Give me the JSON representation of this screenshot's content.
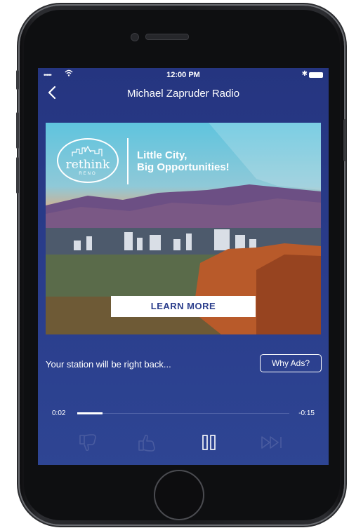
{
  "status_bar": {
    "signal": "•••••",
    "time": "12:00 PM",
    "bluetooth": "✱"
  },
  "nav": {
    "back_icon": "chevron-left-icon",
    "back_glyph": "‹",
    "title": "Michael Zapruder Radio"
  },
  "ad": {
    "logo_text": "rethink",
    "logo_subtext": "RENO",
    "headline_line1": "Little City,",
    "headline_line2": "Big Opportunities!",
    "cta_label": "LEARN MORE"
  },
  "station": {
    "message": "Your station will be right back...",
    "why_ads_label": "Why Ads?"
  },
  "playback": {
    "elapsed": "0:02",
    "remaining": "-0:15",
    "progress": 0.12
  },
  "controls": {
    "thumbs_down_icon": "thumbs-down-icon",
    "thumbs_up_icon": "thumbs-up-icon",
    "pause_icon": "pause-icon",
    "skip_icon": "skip-forward-icon"
  },
  "colors": {
    "screen_background": "#2a3d8c",
    "accent": "#ffffff",
    "cta_text": "#2b3e8c",
    "disabled_control": "#4a5ca0"
  }
}
